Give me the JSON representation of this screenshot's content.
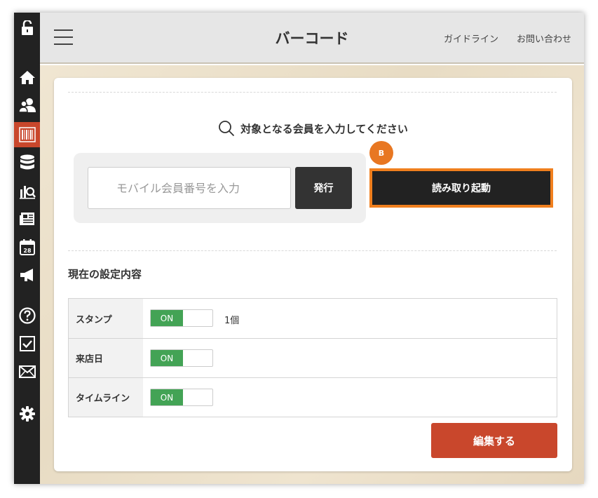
{
  "header": {
    "title": "バーコード",
    "links": [
      "ガイドライン",
      "お問い合わせ"
    ]
  },
  "sidebar": {
    "icons": [
      "unlock-icon",
      "home-icon",
      "members-icon",
      "barcode-icon",
      "database-icon",
      "analytics-icon",
      "news-icon",
      "calendar-icon",
      "megaphone-icon",
      "help-icon",
      "checkbox-icon",
      "mail-icon",
      "gear-icon"
    ],
    "active": "barcode-icon",
    "calendar_day": "28"
  },
  "scan": {
    "prompt": "対象となる会員を入力してください",
    "input_placeholder": "モバイル会員番号を入力",
    "issue_label": "発行",
    "badge": "B",
    "scan_label": "読み取り起動"
  },
  "settings": {
    "heading": "現在の設定内容",
    "rows": [
      {
        "label": "スタンプ",
        "toggle": "ON",
        "extra": "1個"
      },
      {
        "label": "来店日",
        "toggle": "ON",
        "extra": ""
      },
      {
        "label": "タイムライン",
        "toggle": "ON",
        "extra": ""
      }
    ],
    "edit_label": "編集する"
  },
  "colors": {
    "accent": "#c9472c",
    "highlight": "#f07f1e",
    "toggle_on": "#43a355",
    "sidebar": "#222222"
  }
}
